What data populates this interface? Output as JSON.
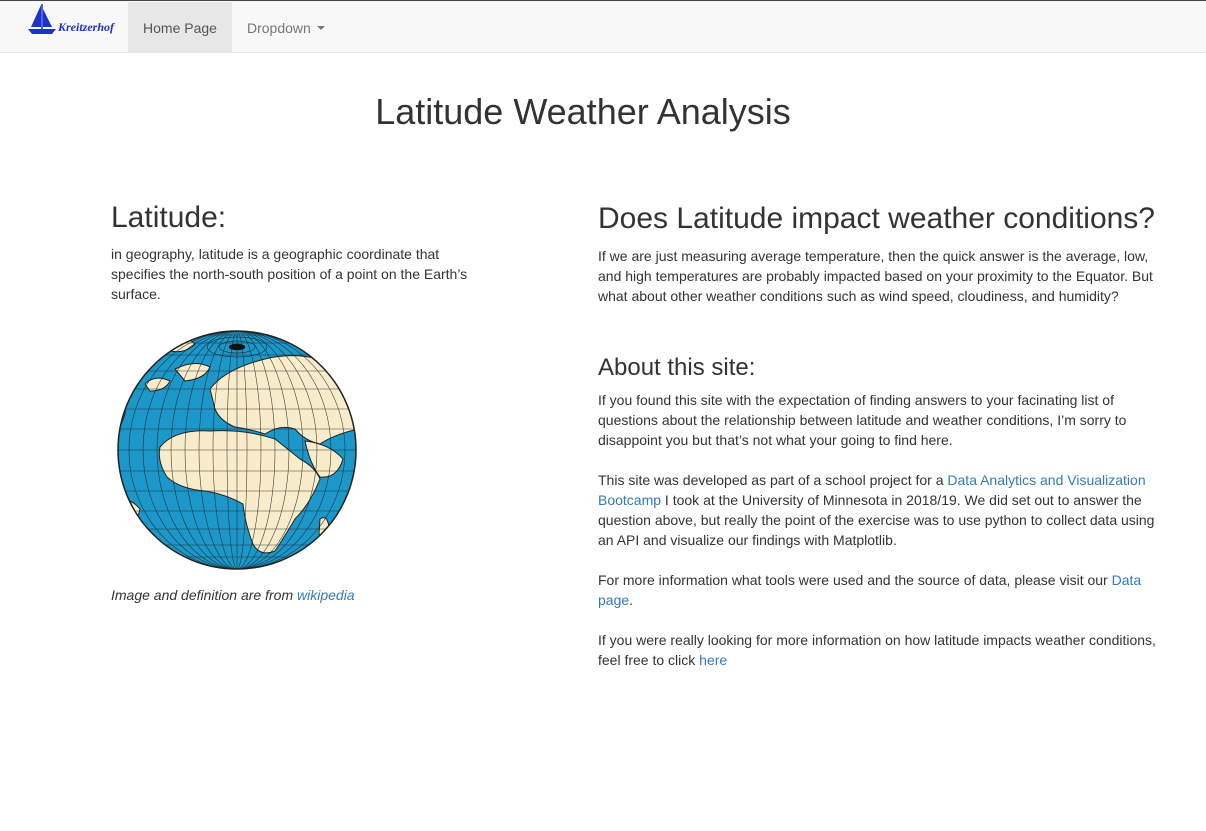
{
  "navbar": {
    "brand_text": "Kreitzerhof",
    "home_label": "Home Page",
    "dropdown_label": "Dropdown",
    "brand_color": "#1a33cc"
  },
  "page_title": "Latitude Weather Analysis",
  "left": {
    "heading": "Latitude:",
    "definition": "in geography, latitude is a geographic coordinate that specifies the north-south position of a point on the Earth’s surface.",
    "credit_prefix": "Image and definition are from ",
    "credit_link": "wikipedia",
    "globe_ocean_color": "#1b98c9",
    "globe_land_color": "#f9ecca"
  },
  "right": {
    "question_heading": "Does Latitude impact weather conditions?",
    "question_body": "If we are just measuring average temperature, then the quick answer is the average, low, and high temperatures are probably impacted based on your proximity to the Equator. But what about other weather conditions such as wind speed, cloudiness, and humidity?",
    "about_heading": "About this site:",
    "about_p1": "If you found this site with the expectation of finding answers to your facinating list of questions about the relationship between latitude and weather conditions, I’m sorry to disappoint you but that’s not what your going to find here.",
    "about_p2_prefix": "This site was developed as part of a school project for a ",
    "about_p2_link": "Data Analytics and Visualization Bootcamp",
    "about_p2_suffix": " I took at the University of Minnesota in 2018/19. We did set out to answer the question above, but really the point of the exercise was to use python to collect data using an API and visualize our findings with Matplotlib.",
    "about_p3_prefix": "For more information what tools were used and the source of data, please visit our ",
    "about_p3_link": "Data page",
    "about_p3_suffix": ".",
    "about_p4_prefix": "If you were really looking for more information on how latitude impacts weather conditions, feel free to click ",
    "about_p4_link": "here",
    "link_color": "#337ab7"
  }
}
